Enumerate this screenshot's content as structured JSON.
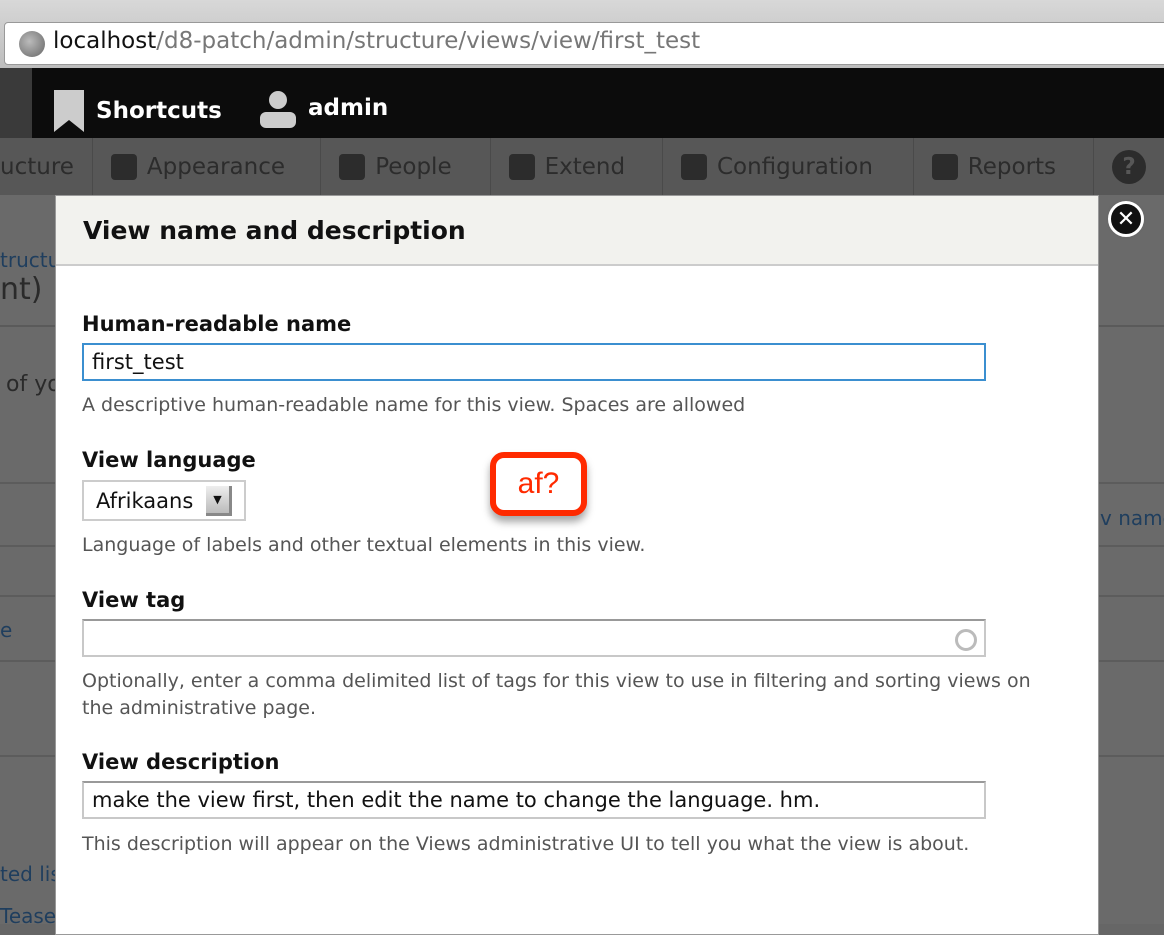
{
  "browser": {
    "url_host": "localhost",
    "url_path": "/d8-patch/admin/structure/views/view/first_test"
  },
  "toolbar": {
    "shortcuts": "Shortcuts",
    "user": "admin"
  },
  "nav": {
    "items": [
      {
        "label": "ucture",
        "icon": "structure-icon"
      },
      {
        "label": "Appearance",
        "icon": "paintbrush-icon"
      },
      {
        "label": "People",
        "icon": "people-icon"
      },
      {
        "label": "Extend",
        "icon": "plug-icon"
      },
      {
        "label": "Configuration",
        "icon": "wrench-icon"
      },
      {
        "label": "Reports",
        "icon": "reports-icon"
      },
      {
        "label": "?",
        "icon": "help-icon"
      }
    ]
  },
  "background": {
    "breadcrumb": "tructu",
    "title_fragment": "nt)",
    "text_fragment": "of yo",
    "col_fragment": "v name",
    "link1": "e",
    "link2": "ted lis",
    "link3": "Tease"
  },
  "modal": {
    "title": "View name and description",
    "close": "✕",
    "name_label": "Human-readable name",
    "name_value": "first_test",
    "name_desc": "A descriptive human-readable name for this view. Spaces are allowed",
    "lang_label": "View language",
    "lang_value": "Afrikaans",
    "lang_desc": "Language of labels and other textual elements in this view.",
    "tag_label": "View tag",
    "tag_value": "",
    "tag_desc": "Optionally, enter a comma delimited list of tags for this view to use in filtering and sorting views on the administrative page.",
    "desc_label": "View description",
    "desc_value": "make the view first, then edit the name to change the language. hm.",
    "desc_desc": "This description will appear on the Views administrative UI to tell you what the view is about."
  },
  "annotation": {
    "text": "af?",
    "color": "#ff2a00"
  }
}
